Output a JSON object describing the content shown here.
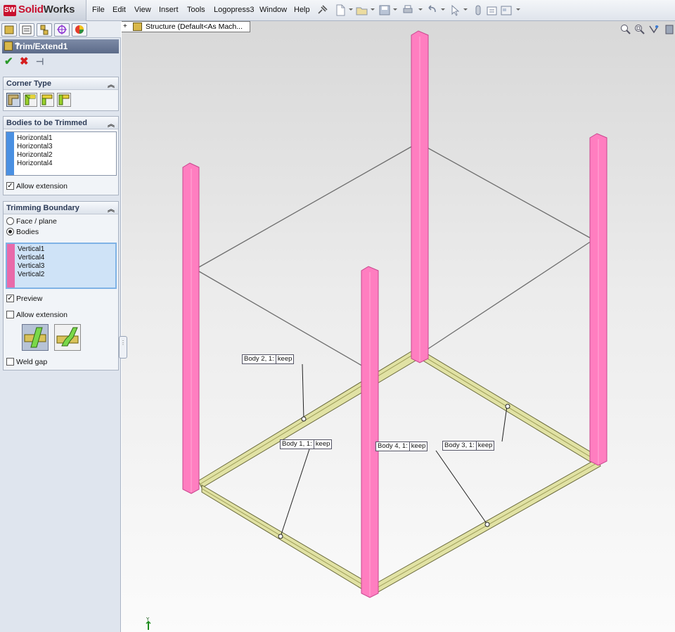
{
  "app": {
    "brand_prefix": "Solid",
    "brand_suffix": "Works"
  },
  "menu": [
    "File",
    "Edit",
    "View",
    "Insert",
    "Tools",
    "Logopress3",
    "Window",
    "Help"
  ],
  "toolbar_icons": [
    "pin-icon",
    "new-icon",
    "open-icon",
    "save-icon",
    "print-icon",
    "undo-icon",
    "select-icon",
    "rebuild-icon",
    "file-properties-icon",
    "options-icon"
  ],
  "panel_tabs": [
    "feature-manager-icon",
    "property-manager-icon",
    "configuration-manager-icon",
    "dimxpert-icon",
    "display-manager-icon"
  ],
  "property_manager": {
    "title": "Trim/Extend1",
    "help": "?",
    "ok_label": "✔",
    "cancel_label": "✖",
    "pin_label": "⊣"
  },
  "corner_type": {
    "title": "Corner Type",
    "options": [
      "end-trim-icon",
      "end-miter-icon",
      "end-butt1-icon",
      "end-butt2-icon"
    ]
  },
  "bodies_to_trim": {
    "title": "Bodies to be Trimmed",
    "items": [
      "Horizontal1",
      "Horizontal3",
      "Horizontal2",
      "Horizontal4"
    ],
    "allow_extension_label": "Allow extension",
    "allow_extension_checked": true,
    "stripe_color": "#4a90e2"
  },
  "trimming_boundary": {
    "title": "Trimming Boundary",
    "radio_face_label": "Face / plane",
    "radio_bodies_label": "Bodies",
    "selected": "Bodies",
    "items": [
      "Vertical1",
      "Vertical4",
      "Vertical3",
      "Vertical2"
    ],
    "stripe_color": "#e86aaa",
    "preview_label": "Preview",
    "preview_checked": true,
    "allow_extension_label": "Allow extension",
    "allow_extension_checked": false,
    "weld_gap_label": "Weld gap",
    "weld_gap_checked": false
  },
  "tree": {
    "expand": "+",
    "label": "Structure  (Default<As Mach..."
  },
  "view_icons": [
    "zoom-to-fit-icon",
    "zoom-area-icon",
    "previous-view-icon",
    "section-view-icon"
  ],
  "callouts": {
    "body2": {
      "name": "Body  2,  1:",
      "action": "keep"
    },
    "body1": {
      "name": "Body  1,  1:",
      "action": "keep"
    },
    "body4": {
      "name": "Body  4,  1:",
      "action": "keep"
    },
    "body3": {
      "name": "Body  3,  1:",
      "action": "keep"
    }
  },
  "colors": {
    "vertical_member": "#ff7ec0",
    "horizontal_member": "#d6d68a",
    "accent": "#5c6b89"
  },
  "triad_label": "Y"
}
